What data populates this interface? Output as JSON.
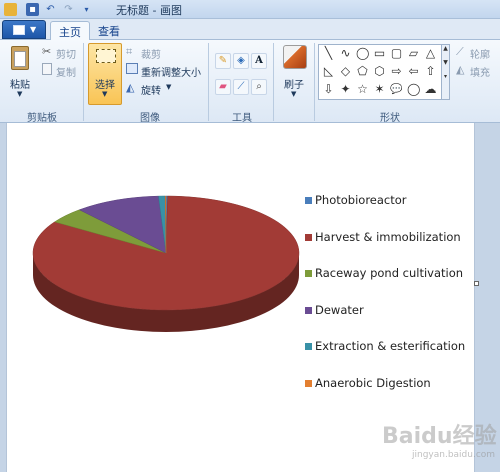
{
  "window": {
    "title": "无标题 - 画图"
  },
  "tabs": [
    {
      "label": "主页"
    },
    {
      "label": "查看"
    }
  ],
  "clipboard": {
    "paste": "粘贴",
    "cut": "剪切",
    "copy": "复制",
    "group": "剪贴板"
  },
  "image": {
    "select": "选择",
    "crop": "裁剪",
    "resize": "重新调整大小",
    "rotate": "旋转",
    "group": "图像"
  },
  "tools": {
    "group": "工具"
  },
  "brushes": {
    "label": "刷子"
  },
  "shapes": {
    "group": "形状",
    "outline": "轮廓",
    "fill": "填充",
    "icons": [
      "╲",
      "∿",
      "◯",
      "▭",
      "▢",
      "▱",
      "△",
      "◺",
      "◇",
      "⬠",
      "⬡",
      "⇨",
      "⇦",
      "⇧",
      "⇩",
      "✦",
      "☆",
      "✶",
      "💬",
      "◯",
      "☁"
    ]
  },
  "colors": {
    "accent": "#1d56a8",
    "photobioreactor": "#4a7ebb",
    "harvest": "#a23b36",
    "raceway": "#7e9c3a",
    "dewater": "#6a4c93",
    "extraction": "#3891a7",
    "anaerobic": "#e37f30"
  },
  "chart_data": {
    "type": "pie",
    "title": "",
    "categories": [
      "Photobioreactor",
      "Harvest & immobilization",
      "Raceway pond cultivation",
      "Dewater",
      "Extraction & esterification",
      "Anaerobic Digestion"
    ],
    "values": [
      0.2,
      84.0,
      4.5,
      10.4,
      0.8,
      0.1
    ],
    "legend_position": "right",
    "style": "3d"
  },
  "watermark": {
    "main": "Baidu经验",
    "sub": "jingyan.baidu.com"
  }
}
